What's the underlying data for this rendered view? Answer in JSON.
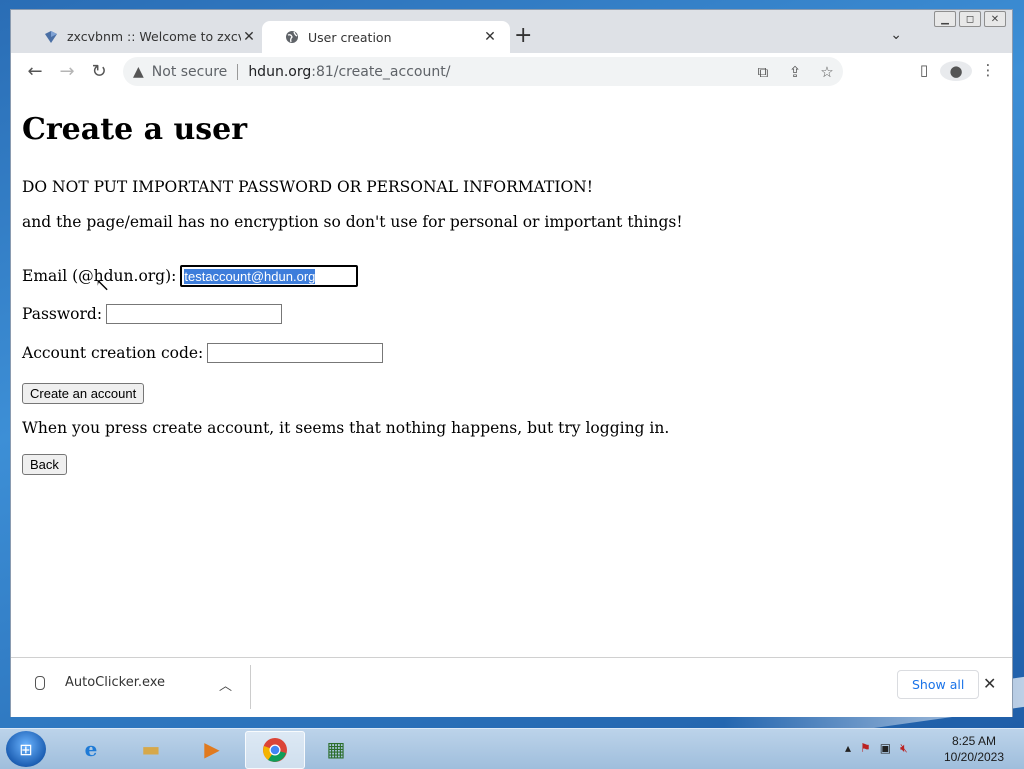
{
  "browser": {
    "tabs": [
      {
        "title": "zxcvbnm :: Welcome to zxcvbnm",
        "active": false
      },
      {
        "title": "User creation",
        "active": true
      }
    ],
    "address": {
      "security_label": "Not secure",
      "host": "hdun.org",
      "rest": ":81/create_account/"
    }
  },
  "page": {
    "heading": "Create a user",
    "warning": "DO NOT PUT IMPORTANT PASSWORD OR PERSONAL INFORMATION!",
    "note": "and the page/email has no encryption so don't use for personal or important things!",
    "email_label": "Email (@hdun.org):",
    "email_value": "testaccount@hdun.org",
    "password_label": "Password:",
    "code_label": "Account creation code:",
    "create_button": "Create an account",
    "hint": "When you press create account, it seems that nothing happens, but try logging in.",
    "back_button": "Back"
  },
  "downloads": {
    "filename": "AutoClicker.exe",
    "show_all": "Show all"
  },
  "taskbar": {
    "time": "8:25 AM",
    "date": "10/20/2023"
  }
}
